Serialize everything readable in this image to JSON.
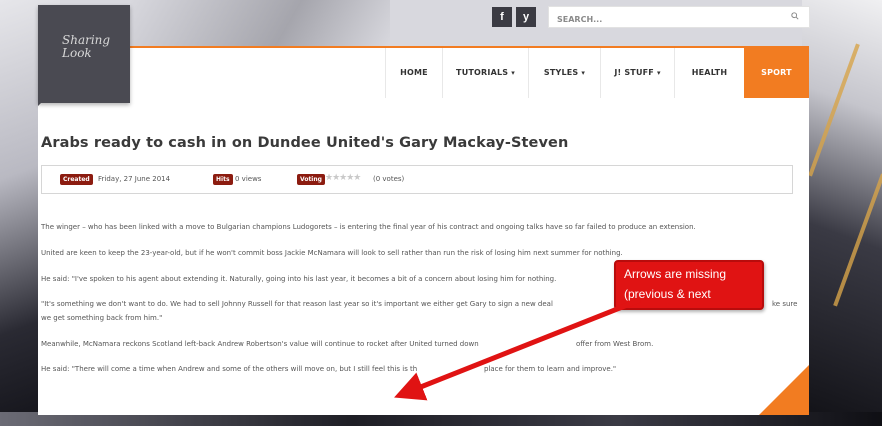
{
  "logo": {
    "line1": "Sharing",
    "line2": "Look"
  },
  "social": {
    "facebook": "f",
    "twitter": "y"
  },
  "search": {
    "placeholder": "SEARCH..."
  },
  "nav": {
    "home": "HOME",
    "tutorials": "TUTORIALS",
    "styles": "STYLES",
    "jstuff": "J! STUFF",
    "health": "HEALTH",
    "sport": "SPORT",
    "dropdown_glyph": "▾"
  },
  "article": {
    "title": "Arabs ready to cash in on Dundee United's Gary Mackay-Steven",
    "meta": {
      "created_label": "Created",
      "created_value": "Friday, 27 June 2014",
      "hits_label": "Hits",
      "hits_value": "0 views",
      "voting_label": "Voting",
      "stars": "★★★★★",
      "votes": "(0 votes)"
    },
    "paragraphs": [
      "The winger – who has been linked with a move to Bulgarian champions Ludogorets – is entering the final year of his contract and ongoing talks have so far failed to produce an extension.",
      "United are keen to keep the 23-year-old, but if he won't commit boss Jackie McNamara will look to sell rather than run the risk of losing him next summer for nothing.",
      "He said: \"I've spoken to his agent about extending it. Naturally, going into his last year, it becomes a bit of a concern about losing him for nothing.",
      "\"It's something we don't want to do. We had to sell Johnny Russell for that reason last year so it's important we either get Gary to sign a new deal",
      "ke sure",
      "we get something back from him.\"",
      "Meanwhile, McNamara reckons Scotland left-back Andrew Robertson's value will continue to rocket after United turned down",
      "offer from West Brom.",
      "He said: \"There will come a time when Andrew and some of the others will move on, but I still feel this is th",
      "place for them to learn and improve.\""
    ]
  },
  "back_to_top": {
    "glyph": "⌃"
  },
  "annotation": {
    "line1": "Arrows are missing",
    "line2": "(previous & next"
  },
  "colors": {
    "accent": "#f27c21",
    "badge": "#8c1c10",
    "annotation": "#e01313"
  }
}
